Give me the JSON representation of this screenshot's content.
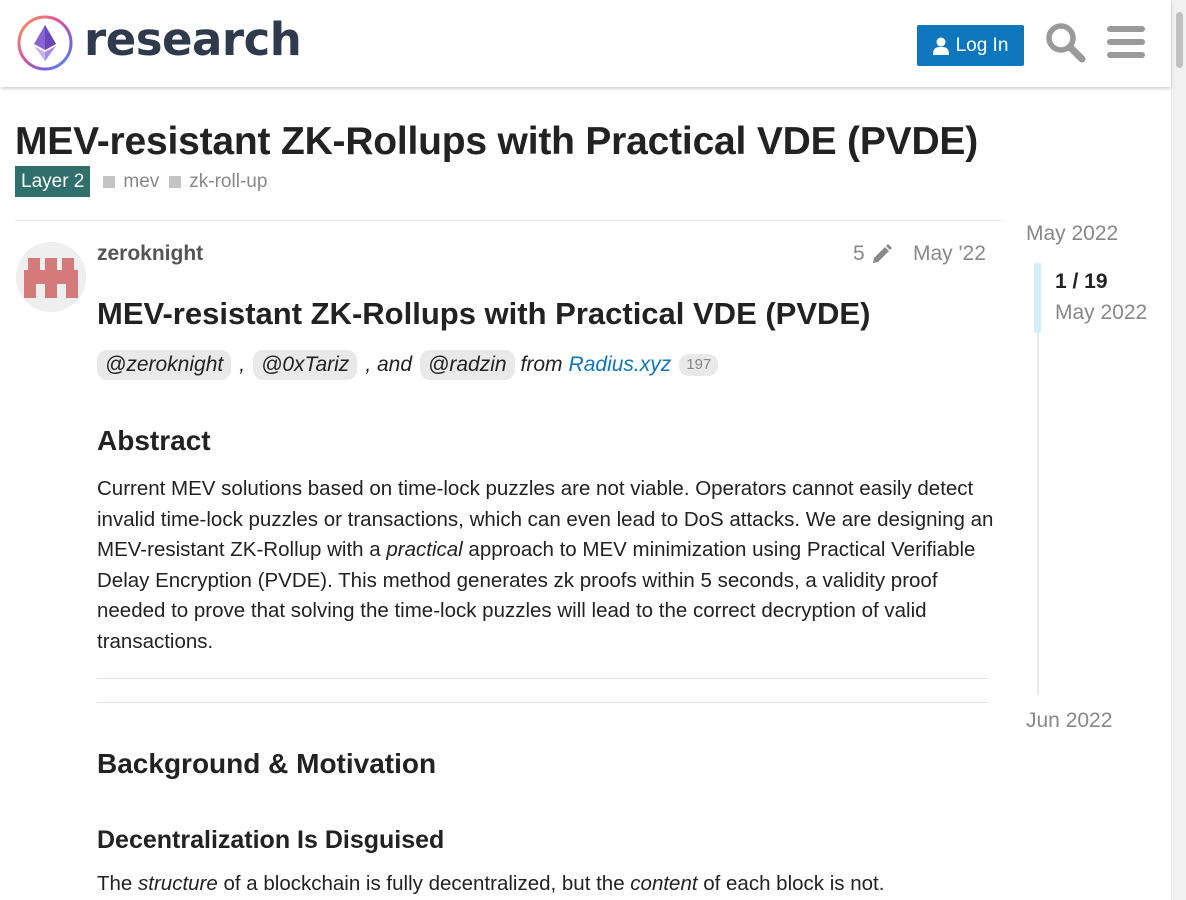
{
  "header": {
    "site_name": "research",
    "login_label": "Log In",
    "icons": [
      "ethereum-logo",
      "user-icon",
      "search-icon",
      "hamburger-menu-icon"
    ],
    "accent_color": "#0e76bd"
  },
  "topic": {
    "title": "MEV-resistant ZK-Rollups with Practical VDE (PVDE)",
    "category": "Layer 2",
    "category_color": "#2f6f6c",
    "tags": [
      "mev",
      "zk-roll-up"
    ]
  },
  "post": {
    "username": "zeroknight",
    "edit_count": "5",
    "date": "May '22",
    "heading": "MEV-resistant ZK-Rollups with Practical VDE (PVDE)",
    "authors": {
      "mention1": "@zeroknight",
      "sep1": ",",
      "mention2": "@0xTariz",
      "sep2": ", and",
      "mention3": "@radzin",
      "from": "from",
      "link": "Radius.xyz",
      "link_clicks": "197"
    },
    "abstract_heading": "Abstract",
    "abstract": {
      "part1": "Current MEV solutions based on time-lock puzzles are not viable. Operators cannot easily detect invalid time-lock puzzles or transactions, which can even lead to DoS attacks. We are designing an MEV-resistant ZK-Rollup with a ",
      "emphasis": "practical",
      "part2": " approach to MEV minimization using Practical Verifiable Delay Encryption (PVDE). This method generates zk proofs within 5 seconds, a validity proof needed to prove that solving the time-lock puzzles will lead to the correct decryption of valid transactions."
    },
    "background_heading": "Background & Motivation",
    "subheading": "Decentralization Is Disguised",
    "last_paragraph": {
      "t1": "The ",
      "em1": "structure",
      "t2": " of a blockchain is fully decentralized, but the ",
      "em2": "content",
      "t3": " of each block is not."
    }
  },
  "timeline": {
    "start_label": "May 2022",
    "position": "1 / 19",
    "current_date": "May 2022",
    "end_label": "Jun 2022"
  }
}
